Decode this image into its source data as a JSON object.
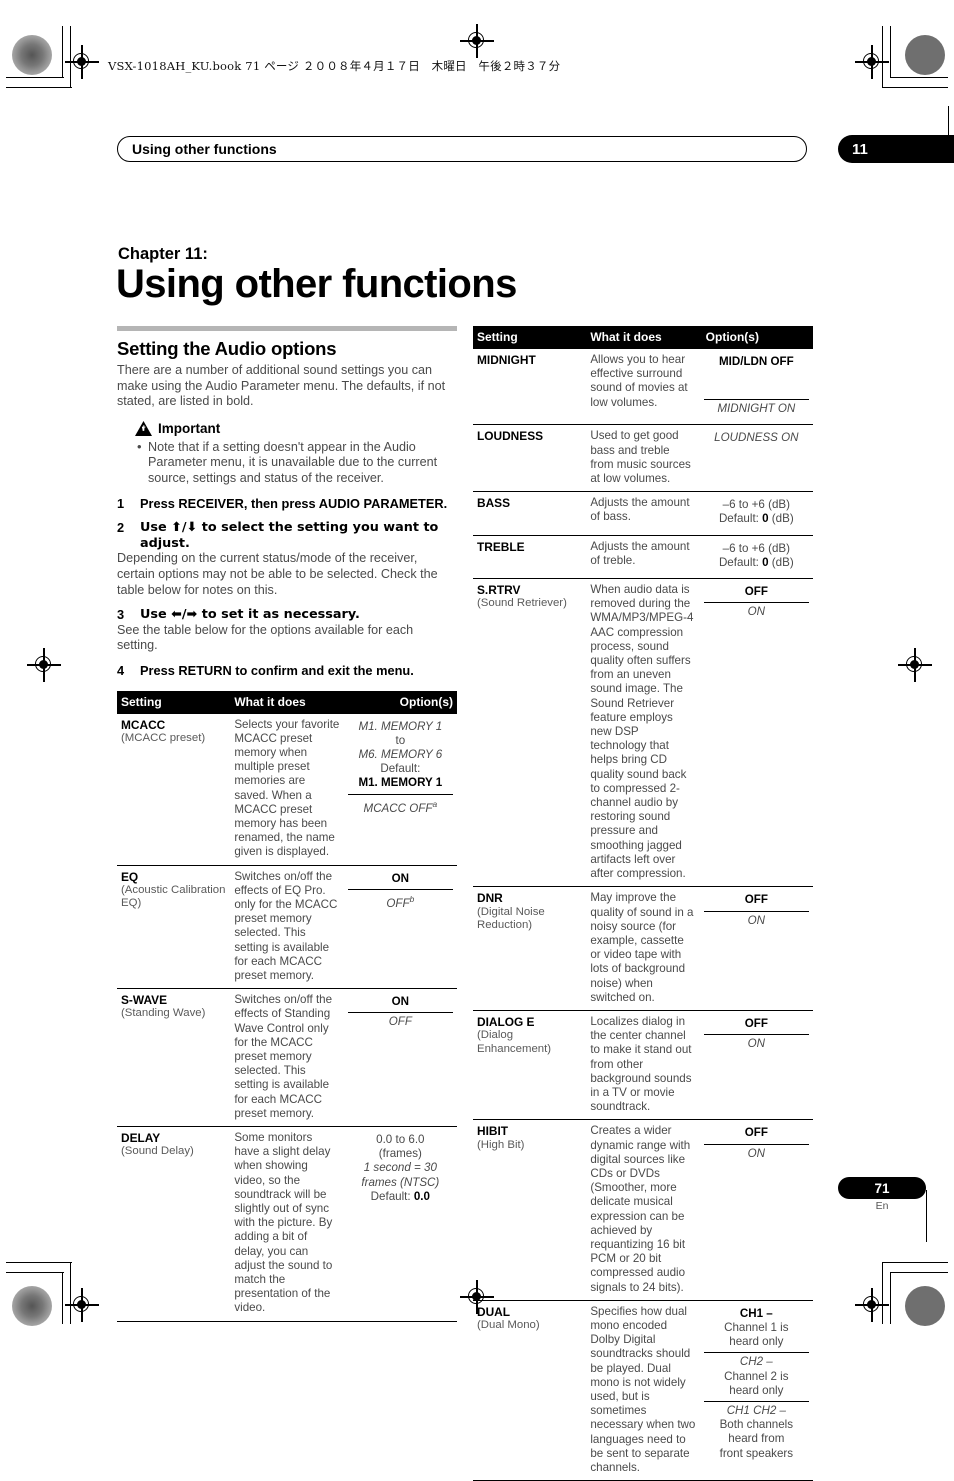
{
  "file_header": "VSX-1018AH_KU.book  71 ページ  ２００８年４月１７日　木曜日　午後２時３７分",
  "running_head": "Using other functions",
  "chapter_number_badge": "11",
  "chapter_label": "Chapter 11:",
  "chapter_title": "Using other functions",
  "left_column": {
    "section_title": "Setting the Audio options",
    "intro": "There are a number of additional sound settings you can make using the Audio Parameter menu. The defaults, if not stated, are listed in bold.",
    "important_label": "Important",
    "important_bullets": [
      "Note that if a setting doesn't appear in the Audio Parameter menu, it is unavailable due to the current source, settings and status of the receiver."
    ],
    "steps": [
      {
        "num": "1",
        "title": "Press RECEIVER, then press AUDIO PARAMETER.",
        "sub": ""
      },
      {
        "num": "2",
        "title": "Use ⬆/⬇ to select the setting you want to adjust.",
        "sub": "Depending on the current status/mode of the receiver, certain options may not be able to be selected. Check the table below for notes on this."
      },
      {
        "num": "3",
        "title": "Use ⬅/➡ to set it as necessary.",
        "sub": "See the table below for the options available for each setting."
      },
      {
        "num": "4",
        "title": "Press RETURN to confirm and exit the menu.",
        "sub": ""
      }
    ]
  },
  "table_headers": [
    "Setting",
    "What it does",
    "Option(s)"
  ],
  "left_table_rows": [
    {
      "setting_name": "MCACC",
      "setting_paren": "(MCACC preset)",
      "what": "Selects your favorite MCACC preset memory when multiple preset memories are saved. When a MCACC preset memory has been renamed, the name given is displayed.",
      "option_blocks": [
        {
          "lines": [
            {
              "text": "M1. MEMORY 1",
              "style": "ital"
            },
            {
              "text": "to",
              "style": "plain"
            },
            {
              "text": "M6. MEMORY 6",
              "style": "ital"
            },
            {
              "text": "Default:",
              "style": "plain"
            },
            {
              "text": "M1. MEMORY 1",
              "style": "bold"
            }
          ]
        },
        {
          "lines": [
            {
              "text": "MCACC OFF",
              "style": "ital",
              "sup": "a"
            }
          ]
        }
      ]
    },
    {
      "setting_name": "EQ",
      "setting_paren": "(Acoustic Calibration EQ)",
      "what": "Switches on/off the effects of EQ Pro. only for the MCACC preset memory selected. This setting is available for each MCACC preset memory.",
      "option_blocks": [
        {
          "lines": [
            {
              "text": "ON",
              "style": "bold"
            }
          ]
        },
        {
          "lines": [
            {
              "text": "OFF",
              "style": "ital",
              "sup": "b"
            }
          ]
        }
      ]
    },
    {
      "setting_name": "S-WAVE",
      "setting_paren": "(Standing Wave)",
      "what": "Switches on/off the effects of Standing Wave Control only for the MCACC preset memory selected. This setting is available for each MCACC preset memory.",
      "option_blocks": [
        {
          "lines": [
            {
              "text": "ON",
              "style": "bold"
            }
          ]
        },
        {
          "lines": [
            {
              "text": "OFF",
              "style": "ital"
            }
          ]
        }
      ]
    },
    {
      "setting_name": "DELAY",
      "setting_paren": "(Sound Delay)",
      "what": "Some monitors have a slight delay when showing video, so the soundtrack will be slightly out of sync with the picture. By adding a bit of delay, you can adjust the sound to match the presentation of the video.",
      "option_blocks": [
        {
          "lines": [
            {
              "text": "0.0 to 6.0",
              "style": "plain"
            },
            {
              "text": "(frames)",
              "style": "plain"
            },
            {
              "text": "1 second = 30",
              "style": "ital"
            },
            {
              "text": "frames (NTSC)",
              "style": "ital"
            },
            {
              "text": "Default: 0.0",
              "style": "default-bold"
            }
          ]
        }
      ]
    }
  ],
  "right_table_rows": [
    {
      "setting_name": "MIDNIGHT",
      "setting_paren": "",
      "what": "Allows you to hear effective surround sound of movies at low volumes.",
      "option_blocks": [
        {
          "lines": [
            {
              "text": "MID/LDN OFF",
              "style": "bold"
            }
          ],
          "tall": true
        },
        {
          "lines": [
            {
              "text": "MIDNIGHT ON",
              "style": "ital"
            }
          ]
        }
      ]
    },
    {
      "setting_name": "LOUDNESS",
      "setting_paren": "",
      "what": "Used to get good bass and treble from music sources at low volumes.",
      "option_blocks": [
        {
          "lines": [
            {
              "text": "LOUDNESS ON",
              "style": "ital"
            }
          ]
        }
      ]
    },
    {
      "setting_name": "BASS",
      "setting_paren": "",
      "what": "Adjusts the amount of bass.",
      "option_blocks": [
        {
          "lines": [
            {
              "text": "–6 to +6 (dB)",
              "style": "plain"
            },
            {
              "text": "Default: 0 (dB)",
              "style": "default-bold-db"
            }
          ]
        }
      ]
    },
    {
      "setting_name": "TREBLE",
      "setting_paren": "",
      "what": "Adjusts the amount of treble.",
      "option_blocks": [
        {
          "lines": [
            {
              "text": "–6 to +6 (dB)",
              "style": "plain"
            },
            {
              "text": "Default: 0 (dB)",
              "style": "default-bold-db"
            }
          ]
        }
      ]
    },
    {
      "setting_name": "S.RTRV",
      "setting_paren": "(Sound Retriever)",
      "what": "When audio data is removed during the WMA/MP3/MPEG-4 AAC compression process, sound quality often suffers from an uneven sound image. The Sound Retriever feature employs new DSP technology that helps bring CD quality sound back to compressed 2-channel audio by restoring sound pressure and smoothing jagged artifacts left over after compression.",
      "option_blocks": [
        {
          "lines": [
            {
              "text": "OFF",
              "style": "bold"
            }
          ]
        },
        {
          "lines": [
            {
              "text": "ON",
              "style": "ital"
            }
          ]
        }
      ]
    },
    {
      "setting_name": "DNR",
      "setting_paren": "(Digital Noise Reduction)",
      "what": "May improve the quality of sound in a noisy source (for example, cassette or video tape with lots of background noise) when switched on.",
      "option_blocks": [
        {
          "lines": [
            {
              "text": "OFF",
              "style": "bold"
            }
          ]
        },
        {
          "lines": [
            {
              "text": "ON",
              "style": "ital"
            }
          ]
        }
      ]
    },
    {
      "setting_name": "DIALOG E",
      "setting_paren": "(Dialog Enhancement)",
      "what": "Localizes dialog in the center channel to make it stand out from other background sounds in a TV or movie soundtrack.",
      "option_blocks": [
        {
          "lines": [
            {
              "text": "OFF",
              "style": "bold"
            }
          ]
        },
        {
          "lines": [
            {
              "text": "ON",
              "style": "ital"
            }
          ]
        }
      ]
    },
    {
      "setting_name": "HIBIT",
      "setting_paren": "(High Bit)",
      "what": "Creates a wider dynamic range with digital sources like CDs or DVDs (Smoother, more delicate musical expression can be achieved by requantizing 16 bit PCM or 20 bit compressed audio signals to 24 bits).",
      "option_blocks": [
        {
          "lines": [
            {
              "text": "OFF",
              "style": "bold"
            }
          ]
        },
        {
          "lines": [
            {
              "text": "ON",
              "style": "ital"
            }
          ]
        }
      ]
    },
    {
      "setting_name": "DUAL",
      "setting_paren": "(Dual Mono)",
      "what": "Specifies how dual mono encoded Dolby Digital soundtracks should be played. Dual mono is not widely used, but is sometimes necessary when two languages need to be sent to separate channels.",
      "option_blocks": [
        {
          "lines": [
            {
              "text": "CH1 –",
              "style": "bold"
            },
            {
              "text": "Channel 1 is",
              "style": "plain"
            },
            {
              "text": "heard only",
              "style": "plain"
            }
          ]
        },
        {
          "lines": [
            {
              "text": "CH2 –",
              "style": "ital"
            },
            {
              "text": "Channel 2 is",
              "style": "plain"
            },
            {
              "text": "heard only",
              "style": "plain"
            }
          ]
        },
        {
          "lines": [
            {
              "text": "CH1 CH2 –",
              "style": "ital"
            },
            {
              "text": "Both channels",
              "style": "plain"
            },
            {
              "text": "heard from",
              "style": "plain"
            },
            {
              "text": "front speakers",
              "style": "plain"
            }
          ]
        }
      ]
    }
  ],
  "footer": {
    "page_number": "71",
    "language_code": "En"
  }
}
